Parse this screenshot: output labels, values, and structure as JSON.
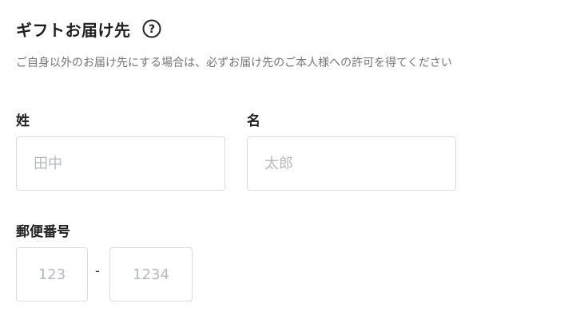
{
  "section": {
    "title": "ギフトお届け先",
    "help_icon": "question-circle-icon",
    "description": "ご自身以外のお届け先にする場合は、必ずお届け先のご本人様への許可を得てください"
  },
  "fields": {
    "last_name": {
      "label": "姓",
      "placeholder": "田中",
      "value": ""
    },
    "first_name": {
      "label": "名",
      "placeholder": "太郎",
      "value": ""
    },
    "postal_code": {
      "label": "郵便番号",
      "part1_placeholder": "123",
      "separator": "-",
      "part2_placeholder": "1234"
    }
  }
}
